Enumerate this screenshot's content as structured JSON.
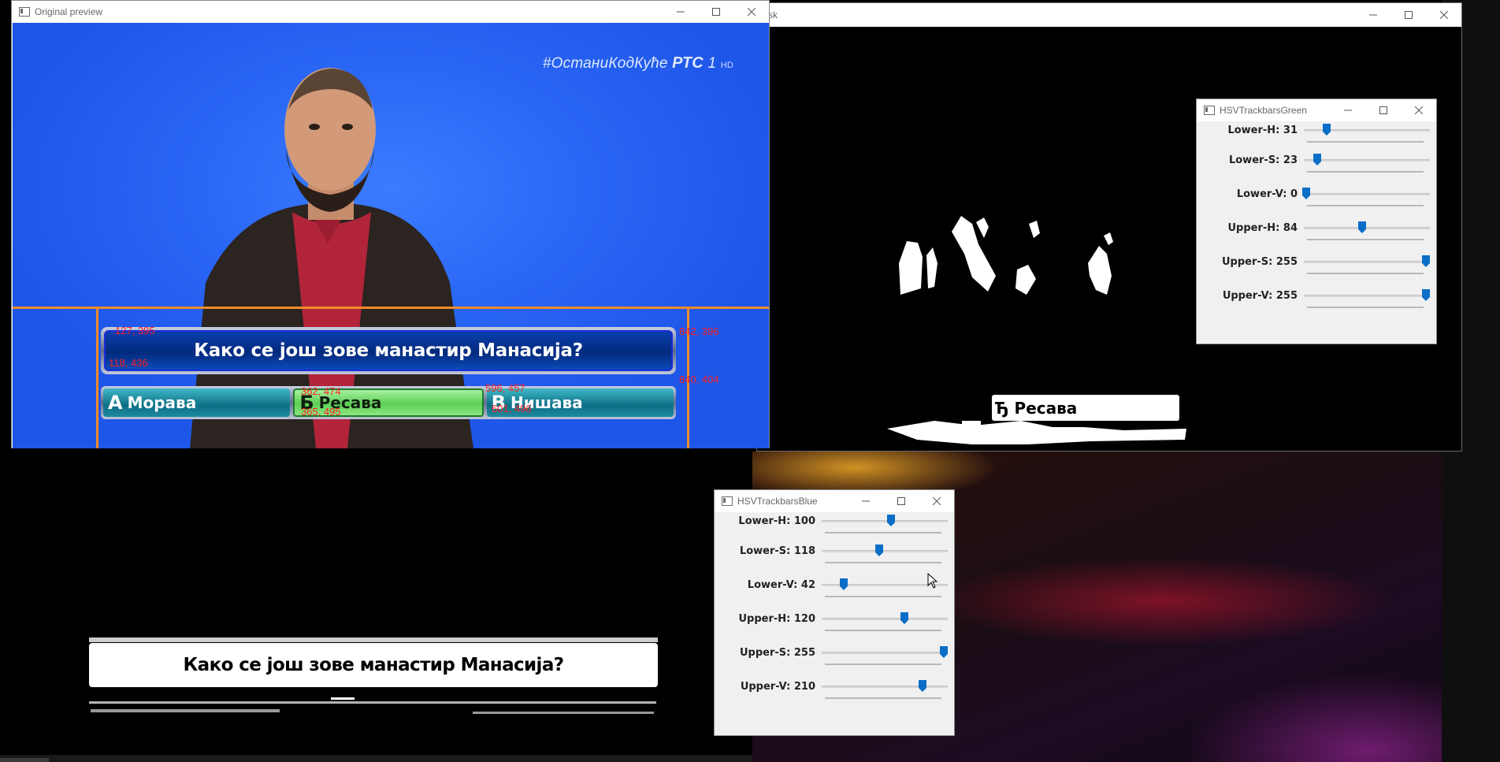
{
  "preview_window": {
    "title": "Original preview",
    "osd": {
      "hashtag": "#ОстаниКодКуће",
      "channel": "РТС",
      "number": "1",
      "quality": "HD"
    },
    "question": "Како се још зове манастир Манасија?",
    "answers": [
      {
        "letter": "A",
        "text": "Морава",
        "selected": false
      },
      {
        "letter": "Б",
        "text": "Ресава",
        "selected": true
      },
      {
        "letter": "В",
        "text": "Нишава",
        "selected": false
      }
    ],
    "debug_coords": [
      "127, 395",
      "118, 436",
      "842, 396",
      "840, 404",
      "362, 474",
      "365, 495",
      "596, 457",
      "601, 496"
    ],
    "accent_color": "#f08a2a"
  },
  "mask_window": {
    "title_visible": "sk",
    "answer_text": "Ђ Ресава"
  },
  "bottom_mask": {
    "question_text": "Како се још зове манастир Манасија?"
  },
  "green_trackbars": {
    "title": "HSVTrackbarsGreen",
    "rows": [
      {
        "label": "Lower-H: 31",
        "value": 31,
        "max": 179
      },
      {
        "label": "Lower-S: 23",
        "value": 23,
        "max": 255
      },
      {
        "label": "Lower-V: 0",
        "value": 0,
        "max": 255
      },
      {
        "label": "Upper-H: 84",
        "value": 84,
        "max": 179
      },
      {
        "label": "Upper-S: 255",
        "value": 255,
        "max": 255
      },
      {
        "label": "Upper-V: 255",
        "value": 255,
        "max": 255
      }
    ]
  },
  "blue_trackbars": {
    "title": "HSVTrackbarsBlue",
    "rows": [
      {
        "label": "Lower-H: 100",
        "value": 100,
        "max": 179
      },
      {
        "label": "Lower-S: 118",
        "value": 118,
        "max": 255
      },
      {
        "label": "Lower-V: 42",
        "value": 42,
        "max": 255
      },
      {
        "label": "Upper-H: 120",
        "value": 120,
        "max": 179
      },
      {
        "label": "Upper-S: 255",
        "value": 255,
        "max": 255
      },
      {
        "label": "Upper-V: 210",
        "value": 210,
        "max": 255
      }
    ]
  },
  "colors": {
    "thumb": "#0a6ec8",
    "preview_bg": "#2a66f5"
  }
}
